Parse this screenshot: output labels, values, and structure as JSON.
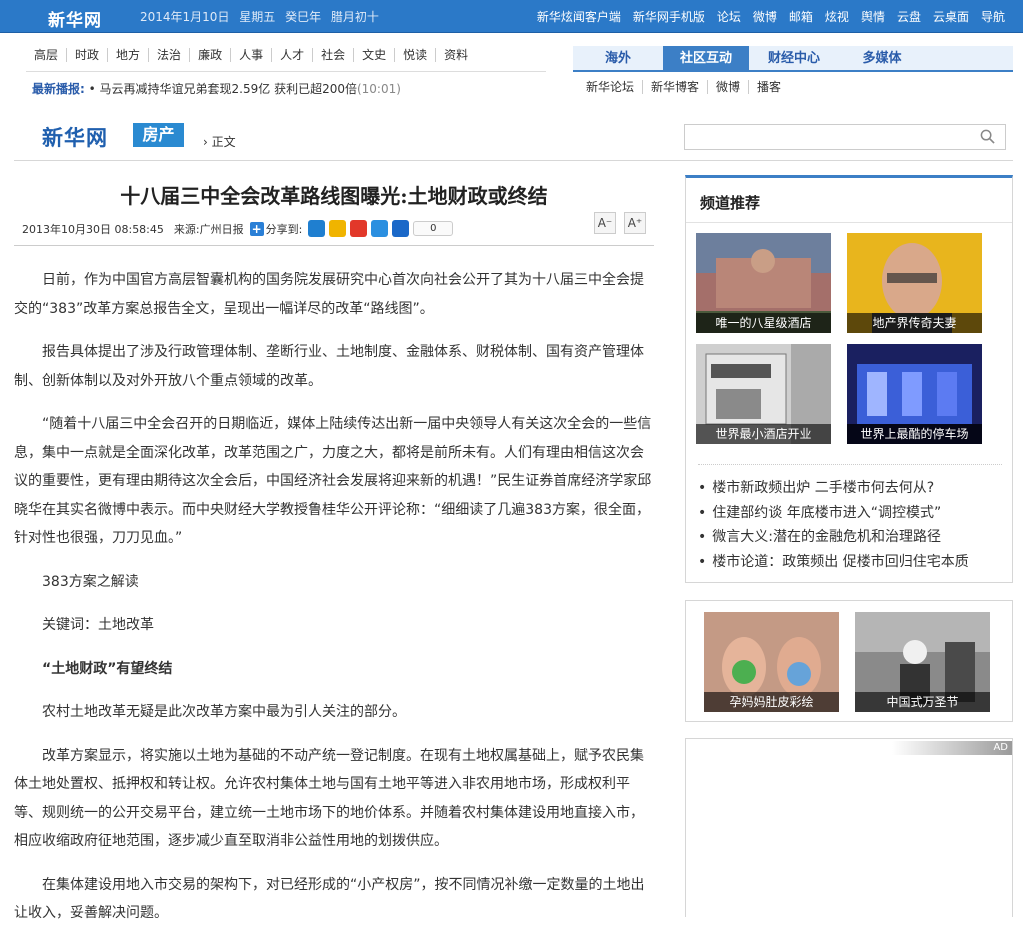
{
  "topbar": {
    "logo": "新华网",
    "date": "2014年1月10日 星期五 癸巳年 腊月初十",
    "links": [
      "新华炫闻客户端",
      "新华网手机版",
      "论坛",
      "微博",
      "邮箱",
      "炫视",
      "舆情",
      "云盘",
      "云桌面",
      "导航"
    ]
  },
  "nav": {
    "items": [
      "高层",
      "时政",
      "地方",
      "法治",
      "廉政",
      "人事",
      "人才",
      "社会",
      "文史",
      "悦读",
      "资料"
    ]
  },
  "ticker": {
    "label": "最新播报:",
    "text": "• 马云再减持华谊兄弟套现2.59亿 获利已超200倍",
    "time": "(10:01)"
  },
  "tabs": {
    "items": [
      "海外",
      "社区互动",
      "财经中心",
      "多媒体"
    ],
    "active": "社区互动"
  },
  "subtabs": {
    "items": [
      "新华论坛",
      "新华博客",
      "微博",
      "播客"
    ]
  },
  "subheader": {
    "brand": "新华网",
    "channel": "房产",
    "breadcrumb": "› 正文"
  },
  "search": {
    "placeholder": ""
  },
  "article": {
    "title": "十八届三中全会改革路线图曝光:土地财政或终结",
    "datetime": "2013年10月30日 08:58:45",
    "source_label": "来源:",
    "source": "广州日报",
    "share_label": "分享到:",
    "share_count": "0",
    "font_smaller": "A⁻",
    "font_larger": "A⁺",
    "paragraphs": [
      "日前，作为中国官方高层智囊机构的国务院发展研究中心首次向社会公开了其为十八届三中全会提交的“383”改革方案总报告全文，呈现出一幅详尽的改革“路线图”。",
      "报告具体提出了涉及行政管理体制、垄断行业、土地制度、金融体系、财税体制、国有资产管理体制、创新体制以及对外开放八个重点领域的改革。",
      "“随着十八届三中全会召开的日期临近，媒体上陆续传达出新一届中央领导人有关这次全会的一些信息，集中一点就是全面深化改革，改革范围之广，力度之大，都将是前所未有。人们有理由相信这次会议的重要性，更有理由期待这次全会后，中国经济社会发展将迎来新的机遇！”民生证券首席经济学家邱晓华在其实名微博中表示。而中央财经大学教授鲁桂华公开评论称：“细细读了几遍383方案，很全面，针对性也很强，刀刀见血。”",
      "383方案之解读",
      "关键词：土地改革",
      "“土地财政”有望终结",
      "农村土地改革无疑是此次改革方案中最为引人关注的部分。",
      "改革方案显示，将实施以土地为基础的不动产统一登记制度。在现有土地权属基础上，赋予农民集体土地处置权、抵押权和转让权。允许农村集体土地与国有土地平等进入非农用地市场，形成权利平等、规则统一的公开交易平台，建立统一土地市场下的地价体系。并随着农村集体建设用地直接入市，相应收缩政府征地范围，逐步减少直至取消非公益性用地的划拨供应。",
      "在集体建设用地入市交易的架构下，对已经形成的“小产权房”，按不同情况补缴一定数量的土地出让收入，妥善解决问题。"
    ]
  },
  "sidebar": {
    "recommend_title": "频道推荐",
    "thumbs": [
      "唯一的八星级酒店",
      "地产界传奇夫妻",
      "世界最小酒店开业",
      "世界上最酷的停车场"
    ],
    "news": [
      "楼市新政频出炉 二手楼市何去何从?",
      "住建部约谈 年底楼市进入“调控模式”",
      "微言大义:潜在的金融危机和治理路径",
      "楼市论道：政策频出 促楼市回归住宅本质"
    ],
    "photo_thumbs": [
      "孕妈妈肚皮彩绘",
      "中国式万圣节"
    ],
    "ad_label": "AD"
  },
  "colors": {
    "topbar": "#2b79c8",
    "accent": "#3c7fc6",
    "link_blue": "#2a5caa"
  }
}
